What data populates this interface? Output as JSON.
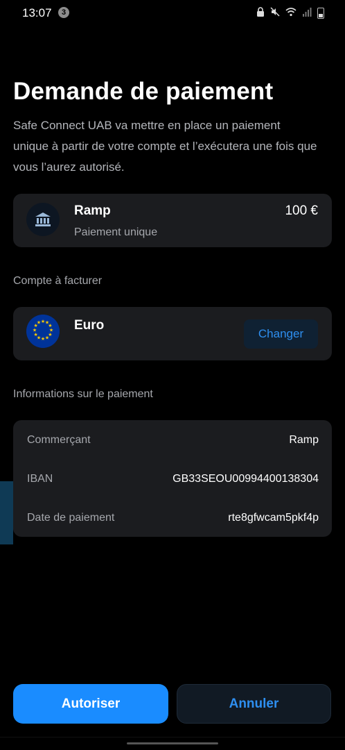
{
  "status_bar": {
    "time": "13:07",
    "notification_count": "3"
  },
  "header": {
    "title": "Demande de paiement",
    "subtitle": "Safe Connect UAB va mettre en place un paiement unique à partir de votre compte et l’exécutera une fois que vous l’aurez autorisé."
  },
  "merchant": {
    "icon": "bank-icon",
    "name": "Ramp",
    "type": "Paiement unique",
    "amount": "100 €"
  },
  "account_section": {
    "label": "Compte à facturer",
    "account_name": "Euro",
    "flag_icon": "eu-flag-icon",
    "change_label": "Changer"
  },
  "info_section": {
    "label": "Informations sur le paiement",
    "rows": [
      {
        "key": "Commerçant",
        "value": "Ramp"
      },
      {
        "key": "IBAN",
        "value": "GB33SEOU00994400138304"
      },
      {
        "key": "Date de paiement",
        "value": "rte8gfwcam5pkf4p"
      }
    ]
  },
  "actions": {
    "authorize_label": "Autoriser",
    "cancel_label": "Annuler"
  },
  "colors": {
    "background": "#000000",
    "card": "#1b1c1f",
    "primary": "#1a8cff",
    "link": "#2e8ff0"
  }
}
